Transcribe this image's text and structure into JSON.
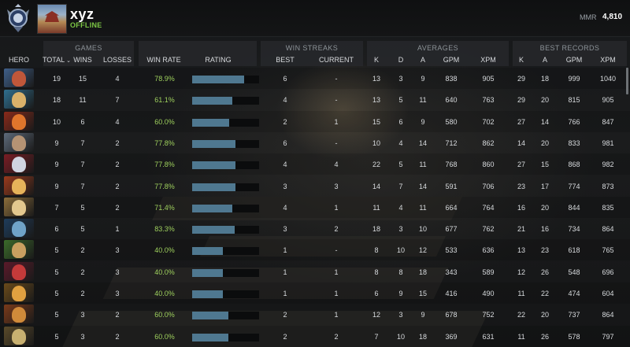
{
  "profile": {
    "username": "xyz",
    "status": "OFFLINE",
    "mmr_label": "MMR",
    "mmr_value": "4,810"
  },
  "groups": {
    "games": "GAMES",
    "win_streaks": "WIN STREAKS",
    "averages": "AVERAGES",
    "best_records": "BEST RECORDS"
  },
  "columns": {
    "hero": "HERO",
    "total": "TOTAL",
    "wins": "WINS",
    "losses": "LOSSES",
    "win_rate": "WIN RATE",
    "rating": "RATING",
    "best": "BEST",
    "current": "CURRENT",
    "avg_k": "K",
    "avg_d": "D",
    "avg_a": "A",
    "avg_gpm": "GPM",
    "avg_xpm": "XPM",
    "rec_k": "K",
    "rec_a": "A",
    "rec_gpm": "GPM",
    "rec_xpm": "XPM"
  },
  "colors": {
    "win_rate": "#9ed05d",
    "rating_bar": "#4f7890",
    "status_online": "#7cc644"
  },
  "rows": [
    {
      "hero_colors": [
        "#3f5f8a",
        "#c0573a"
      ],
      "total": "19",
      "wins": "15",
      "losses": "4",
      "win_rate": "78.9%",
      "rating": 0.78,
      "best": "6",
      "current": "-",
      "k": "13",
      "d": "3",
      "a": "9",
      "gpm": "838",
      "xpm": "905",
      "rk": "29",
      "ra": "18",
      "rgpm": "999",
      "rxpm": "1040"
    },
    {
      "hero_colors": [
        "#2f6f8f",
        "#d9b16a"
      ],
      "total": "18",
      "wins": "11",
      "losses": "7",
      "win_rate": "61.1%",
      "rating": 0.6,
      "best": "4",
      "current": "-",
      "k": "13",
      "d": "5",
      "a": "11",
      "gpm": "640",
      "xpm": "763",
      "rk": "29",
      "ra": "20",
      "rgpm": "815",
      "rxpm": "905"
    },
    {
      "hero_colors": [
        "#8a2a1a",
        "#e0752c"
      ],
      "total": "10",
      "wins": "6",
      "losses": "4",
      "win_rate": "60.0%",
      "rating": 0.55,
      "best": "2",
      "current": "1",
      "k": "15",
      "d": "6",
      "a": "9",
      "gpm": "580",
      "xpm": "702",
      "rk": "27",
      "ra": "14",
      "rgpm": "766",
      "rxpm": "847"
    },
    {
      "hero_colors": [
        "#5d6a7a",
        "#b59374"
      ],
      "total": "9",
      "wins": "7",
      "losses": "2",
      "win_rate": "77.8%",
      "rating": 0.65,
      "best": "6",
      "current": "-",
      "k": "10",
      "d": "4",
      "a": "14",
      "gpm": "712",
      "xpm": "862",
      "rk": "14",
      "ra": "20",
      "rgpm": "833",
      "rxpm": "981"
    },
    {
      "hero_colors": [
        "#7a1d24",
        "#d0d4e0"
      ],
      "total": "9",
      "wins": "7",
      "losses": "2",
      "win_rate": "77.8%",
      "rating": 0.65,
      "best": "4",
      "current": "4",
      "k": "22",
      "d": "5",
      "a": "11",
      "gpm": "768",
      "xpm": "860",
      "rk": "27",
      "ra": "15",
      "rgpm": "868",
      "rxpm": "982"
    },
    {
      "hero_colors": [
        "#9a3a1c",
        "#e6b25a"
      ],
      "total": "9",
      "wins": "7",
      "losses": "2",
      "win_rate": "77.8%",
      "rating": 0.65,
      "best": "3",
      "current": "3",
      "k": "14",
      "d": "7",
      "a": "14",
      "gpm": "591",
      "xpm": "706",
      "rk": "23",
      "ra": "17",
      "rgpm": "774",
      "rxpm": "873"
    },
    {
      "hero_colors": [
        "#8c6d3a",
        "#e3c88e"
      ],
      "total": "7",
      "wins": "5",
      "losses": "2",
      "win_rate": "71.4%",
      "rating": 0.6,
      "best": "4",
      "current": "1",
      "k": "11",
      "d": "4",
      "a": "11",
      "gpm": "664",
      "xpm": "764",
      "rk": "16",
      "ra": "20",
      "rgpm": "844",
      "rxpm": "835"
    },
    {
      "hero_colors": [
        "#1e3c5a",
        "#6fa3c8"
      ],
      "total": "6",
      "wins": "5",
      "losses": "1",
      "win_rate": "83.3%",
      "rating": 0.63,
      "best": "3",
      "current": "2",
      "k": "18",
      "d": "3",
      "a": "10",
      "gpm": "677",
      "xpm": "762",
      "rk": "21",
      "ra": "16",
      "rgpm": "734",
      "rxpm": "864"
    },
    {
      "hero_colors": [
        "#3b6a2a",
        "#c9a060"
      ],
      "total": "5",
      "wins": "2",
      "losses": "3",
      "win_rate": "40.0%",
      "rating": 0.46,
      "best": "1",
      "current": "-",
      "k": "8",
      "d": "10",
      "a": "12",
      "gpm": "533",
      "xpm": "636",
      "rk": "13",
      "ra": "23",
      "rgpm": "618",
      "rxpm": "765"
    },
    {
      "hero_colors": [
        "#5a1a2a",
        "#c43a3a"
      ],
      "total": "5",
      "wins": "2",
      "losses": "3",
      "win_rate": "40.0%",
      "rating": 0.46,
      "best": "1",
      "current": "1",
      "k": "8",
      "d": "8",
      "a": "18",
      "gpm": "343",
      "xpm": "589",
      "rk": "12",
      "ra": "26",
      "rgpm": "548",
      "rxpm": "696"
    },
    {
      "hero_colors": [
        "#6a4a1a",
        "#e0a040"
      ],
      "total": "5",
      "wins": "2",
      "losses": "3",
      "win_rate": "40.0%",
      "rating": 0.46,
      "best": "1",
      "current": "1",
      "k": "6",
      "d": "9",
      "a": "15",
      "gpm": "416",
      "xpm": "490",
      "rk": "11",
      "ra": "22",
      "rgpm": "474",
      "rxpm": "604"
    },
    {
      "hero_colors": [
        "#7a3a1a",
        "#d08a3a"
      ],
      "total": "5",
      "wins": "3",
      "losses": "2",
      "win_rate": "60.0%",
      "rating": 0.54,
      "best": "2",
      "current": "1",
      "k": "12",
      "d": "3",
      "a": "9",
      "gpm": "678",
      "xpm": "752",
      "rk": "22",
      "ra": "20",
      "rgpm": "737",
      "rxpm": "864"
    },
    {
      "hero_colors": [
        "#5a4a2a",
        "#c8b070"
      ],
      "total": "5",
      "wins": "3",
      "losses": "2",
      "win_rate": "60.0%",
      "rating": 0.54,
      "best": "2",
      "current": "2",
      "k": "7",
      "d": "10",
      "a": "18",
      "gpm": "369",
      "xpm": "631",
      "rk": "11",
      "ra": "26",
      "rgpm": "578",
      "rxpm": "797"
    }
  ]
}
